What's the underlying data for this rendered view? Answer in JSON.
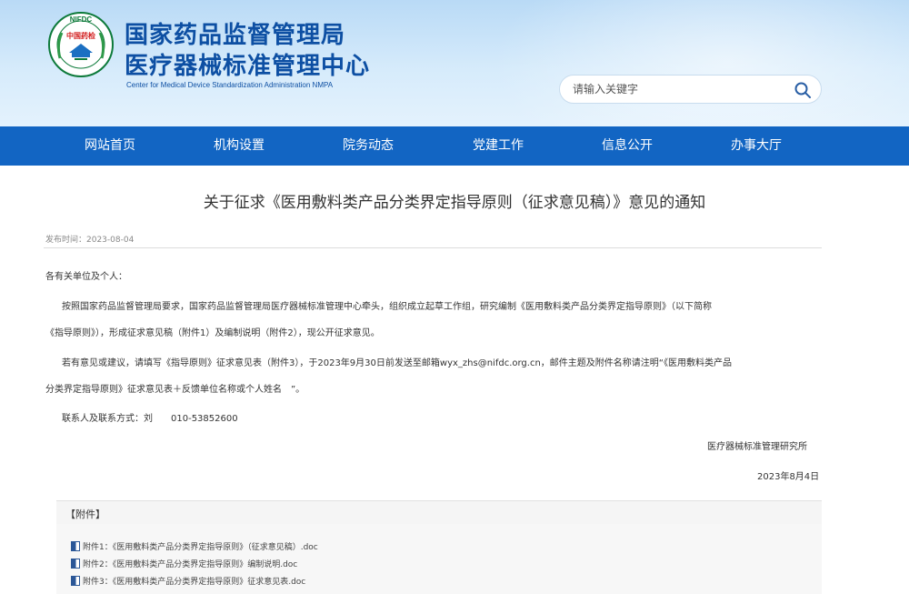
{
  "header": {
    "logo_text_top": "NIFDC",
    "logo_text_mid": "中国药检",
    "title_line1": "国家药品监督管理局",
    "title_line2": "医疗器械标准管理中心",
    "title_en": "Center for Medical Device Standardization Administration NMPA",
    "brand_color": "#0d4fa3"
  },
  "search": {
    "placeholder": "请输入关键字",
    "icon": "search-icon"
  },
  "nav": {
    "color": "#1265c3",
    "items": [
      "网站首页",
      "机构设置",
      "院务动态",
      "党建工作",
      "信息公开",
      "办事大厅"
    ]
  },
  "article": {
    "title": "关于征求《医用敷料类产品分类界定指导原则（征求意见稿）》意见的通知",
    "date": "发布时间：2023-08-04",
    "greeting": "各有关单位及个人：",
    "p1_line1": "按照国家药品监督管理局要求，国家药品监督管理局医疗器械标准管理中心牵头，组织成立起草工作组，研究编制《医用敷料类产品分类界定指导原则》（以下简称",
    "p1_line2": "《指导原则》），形成征求意见稿（附件1）及编制说明（附件2），现公开征求意见。",
    "p2_line1": "若有意见或建议，请填写《指导原则》征求意见表（附件3），于2023年9月30日前发送至邮箱wyx_zhs@nifdc.org.cn，邮件主题及附件名称请注明“《医用敷料类产品",
    "p2_line2": "分类界定指导原则》征求意见表＋反馈单位名称或个人姓名　”。",
    "contact": "联系人及联系方式：刘　　010-53852600",
    "signature": "医疗器械标准管理研究所",
    "sign_date": "2023年8月4日"
  },
  "attachments": {
    "heading": "【附件】",
    "items": [
      "附件1：《医用敷料类产品分类界定指导原则》（征求意见稿）.doc",
      "附件2：《医用敷料类产品分类界定指导原则》编制说明.doc",
      "附件3：《医用敷料类产品分类界定指导原则》征求意见表.doc"
    ]
  }
}
